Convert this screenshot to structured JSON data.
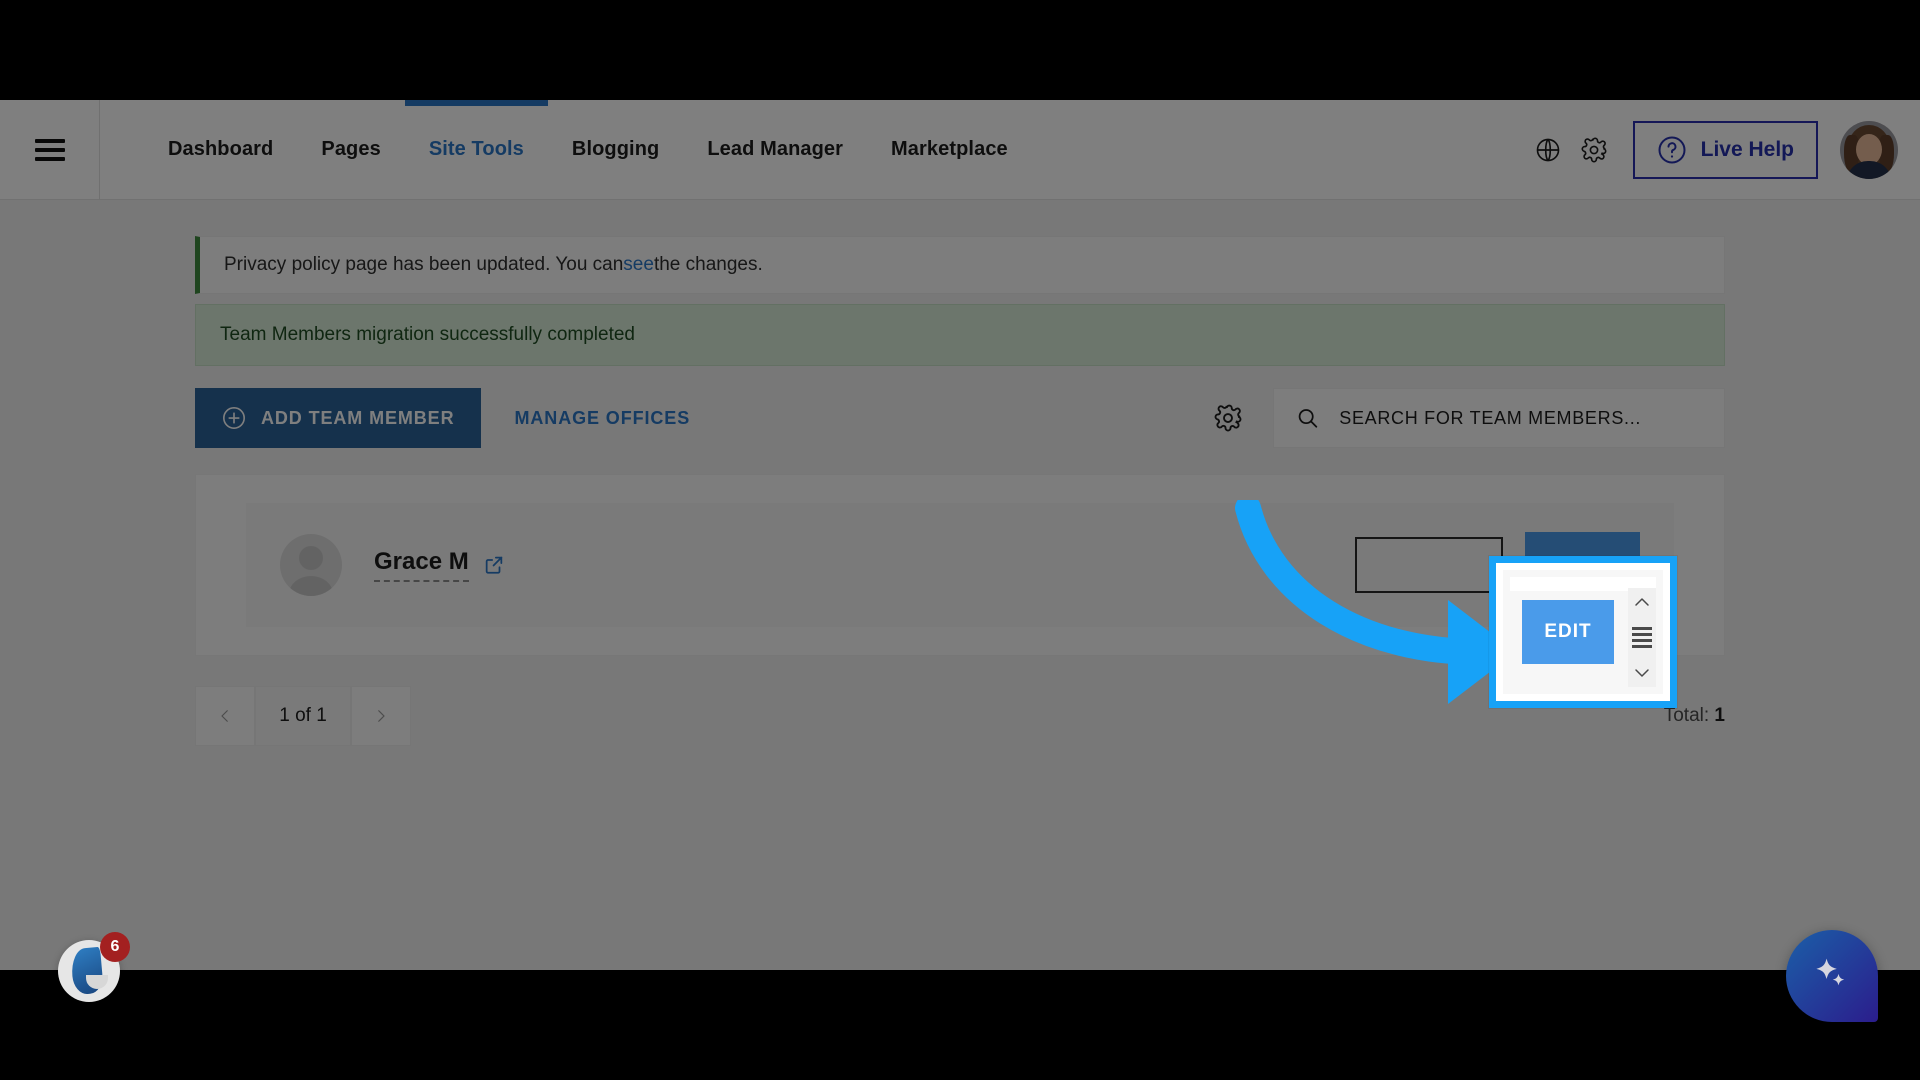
{
  "header": {
    "menu_icon": "hamburger-icon",
    "nav": [
      {
        "label": "Dashboard",
        "active": false
      },
      {
        "label": "Pages",
        "active": false
      },
      {
        "label": "Site Tools",
        "active": true
      },
      {
        "label": "Blogging",
        "active": false
      },
      {
        "label": "Lead Manager",
        "active": false
      },
      {
        "label": "Marketplace",
        "active": false
      }
    ],
    "globe_icon": "globe-icon",
    "gear_icon": "gear-icon",
    "live_help_label": "Live Help",
    "help_icon": "question-circle-icon",
    "avatar": "user-avatar"
  },
  "alerts": [
    {
      "text_before": "Privacy policy page has been updated. You can ",
      "link": "see",
      "text_after": " the changes.",
      "type": "info"
    },
    {
      "text": "Team Members migration successfully completed",
      "type": "success"
    }
  ],
  "toolbar": {
    "add_label": "ADD TEAM MEMBER",
    "add_icon": "plus-circle-icon",
    "manage_offices_label": "MANAGE OFFICES",
    "settings_icon": "gear-icon",
    "search_icon": "search-icon",
    "search_value": "",
    "search_placeholder": "SEARCH FOR TEAM MEMBERS..."
  },
  "members": [
    {
      "name": "Grace M",
      "avatar": "default-person-avatar",
      "external_link_icon": "external-link-icon",
      "office_value": "",
      "edit_label": "EDIT"
    }
  ],
  "pager": {
    "prev_icon": "chevron-left-icon",
    "page_label": "1 of 1",
    "next_icon": "chevron-right-icon",
    "total_label": "Total:",
    "total_value": "1"
  },
  "widgets": {
    "chat_badge": "6",
    "chat_icon": "flame-logo-icon",
    "ai_icon": "sparkle-icon"
  },
  "callout": {
    "edit_label": "EDIT",
    "scroll_up_icon": "chevron-up-icon",
    "scroll_down_icon": "chevron-down-icon",
    "scroll_thumb_icon": "scrollbar-thumb",
    "arrow_icon": "curved-arrow-pointer",
    "highlight_color": "#17a2f7"
  }
}
